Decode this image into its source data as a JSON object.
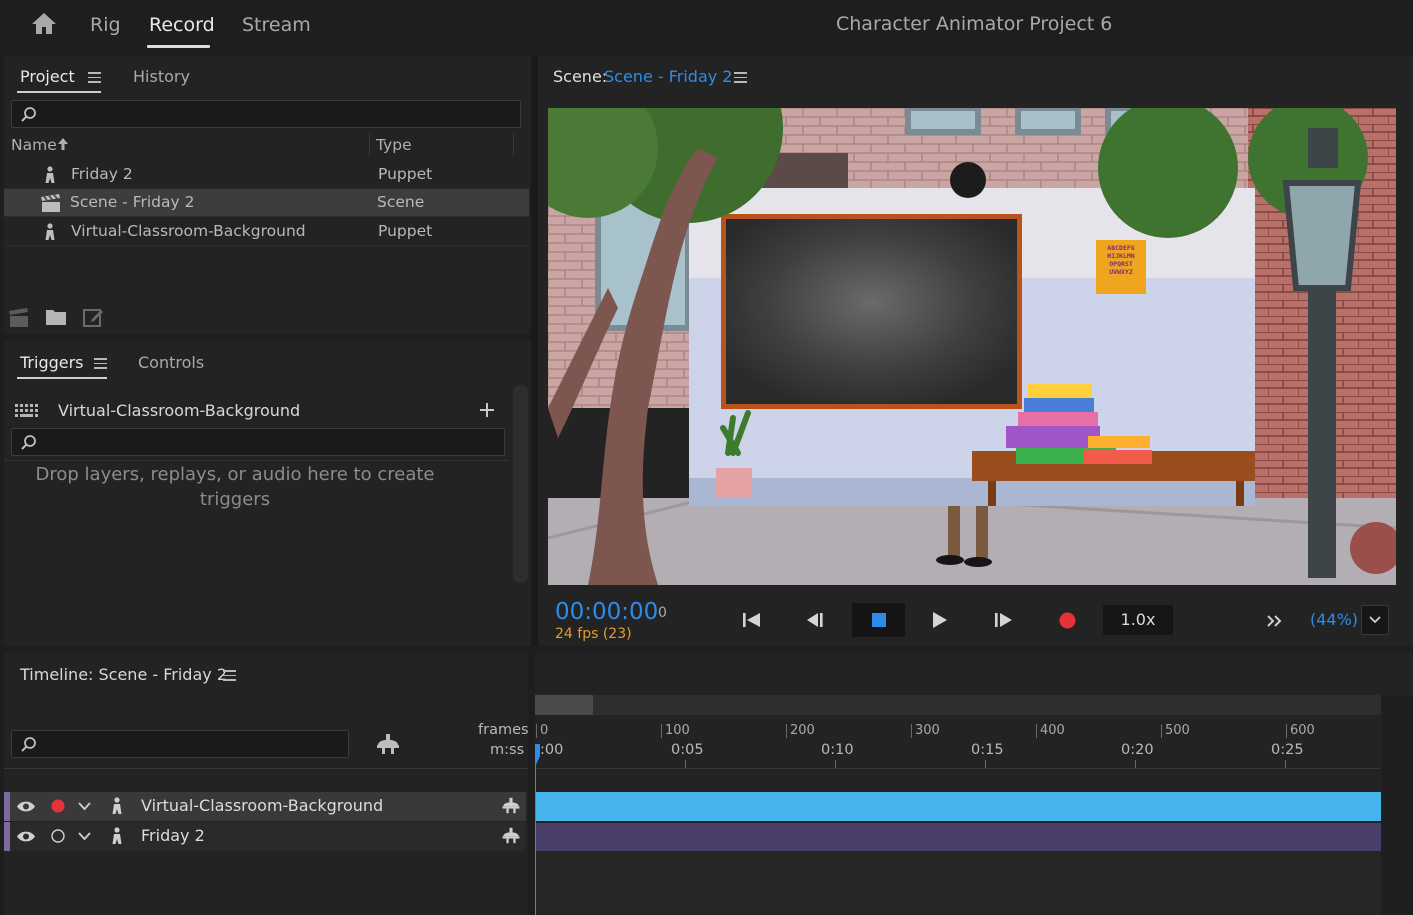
{
  "workspace": {
    "tabs": [
      "Rig",
      "Record",
      "Stream"
    ],
    "active_tab": "Record",
    "app_title": "Character Animator Project 6"
  },
  "project_panel": {
    "tabs": [
      "Project",
      "History"
    ],
    "active_tab": "Project",
    "search_placeholder": "",
    "columns": {
      "name": "Name",
      "type": "Type"
    },
    "items": [
      {
        "name": "Friday 2",
        "type": "Puppet",
        "icon": "puppet-icon",
        "selected": false
      },
      {
        "name": "Scene - Friday 2",
        "type": "Scene",
        "icon": "clapperboard-icon",
        "selected": true
      },
      {
        "name": "Virtual-Classroom-Background",
        "type": "Puppet",
        "icon": "puppet-icon",
        "selected": false
      }
    ],
    "footer_icons": [
      "new-scene-icon",
      "new-folder-icon",
      "new-item-icon"
    ]
  },
  "triggers_panel": {
    "tabs": [
      "Triggers",
      "Controls"
    ],
    "active_tab": "Triggers",
    "puppet_name": "Virtual-Classroom-Background",
    "empty_message": "Drop layers, replays, or audio here to create triggers"
  },
  "scene_panel": {
    "label": "Scene:",
    "scene_name": "Scene - Friday 2",
    "timecode": "00:00:00",
    "frame": "0",
    "fps": "24 fps (23)",
    "speed": "1.0x",
    "zoom": "(44%)",
    "poster_text": [
      "ABCDEFG",
      "HIJKLMN",
      "OPQRST",
      "UVWXYZ"
    ]
  },
  "timeline_panel": {
    "title": "Timeline: Scene - Friday 2",
    "search_placeholder": "",
    "frames_label": "frames",
    "mss_label": "m:ss",
    "frame_ticks": [
      "0",
      "100",
      "200",
      "300",
      "400",
      "500",
      "600"
    ],
    "time_ticks": [
      ":00",
      "0:05",
      "0:10",
      "0:15",
      "0:20",
      "0:25"
    ],
    "tracks": [
      {
        "name": "Virtual-Classroom-Background",
        "armed": true,
        "bar_color": "#45b4ea"
      },
      {
        "name": "Friday 2",
        "armed": false,
        "bar_color": "#4a3f6b"
      }
    ]
  },
  "colors": {
    "accent_blue": "#2d8ceb",
    "orange": "#e49d2f",
    "record_red": "#e8323a",
    "track_blue": "#45b4ea",
    "track_purple": "#4a3f6b"
  }
}
